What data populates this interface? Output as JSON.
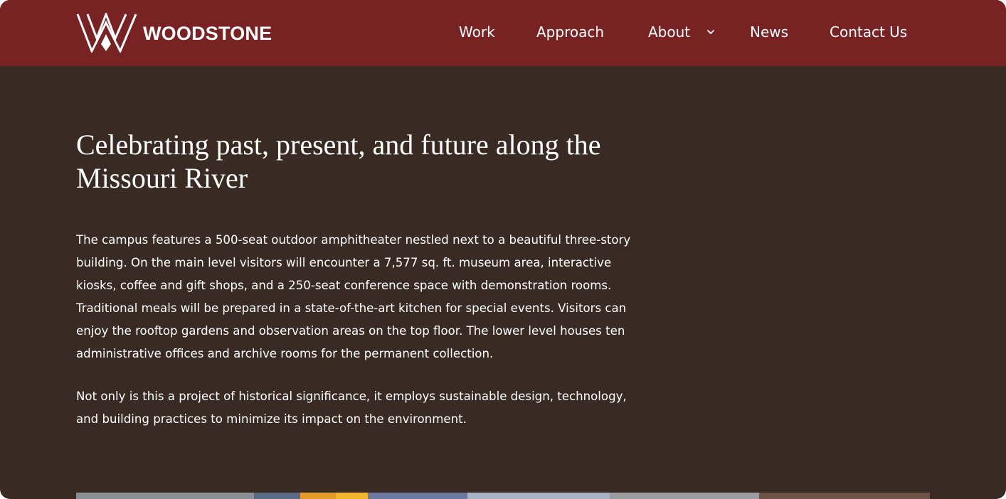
{
  "header": {
    "logo_text": "WOODSTONE",
    "nav": [
      {
        "label": "Work"
      },
      {
        "label": "Approach"
      },
      {
        "label": "About",
        "has_dropdown": true
      },
      {
        "label": "News"
      },
      {
        "label": "Contact Us"
      }
    ]
  },
  "main": {
    "title": "Celebrating past, present, and future along the Missouri River",
    "paragraphs": [
      "The campus features a 500-seat outdoor amphitheater nestled next to a beautiful three-story building. On the main level visitors will encounter a 7,577 sq. ft. museum area, interactive kiosks, coffee and gift shops, and a 250-seat conference space with demonstration rooms. Traditional meals will be prepared in a state-of-the-art kitchen for special events. Visitors can enjoy the rooftop gardens and observation areas on the top floor. The lower level houses ten administrative offices and archive rooms for the permanent collection.",
      "Not only is this a project of historical significance, it employs sustainable design, technology, and building practices to minimize its impact on the environment."
    ]
  },
  "icons": {
    "logo": "woodstone-w-logo-icon",
    "dropdown": "chevron-down-icon"
  },
  "colors": {
    "header_bg": "#792224",
    "page_bg": "#392b24",
    "text": "#ffffff"
  }
}
